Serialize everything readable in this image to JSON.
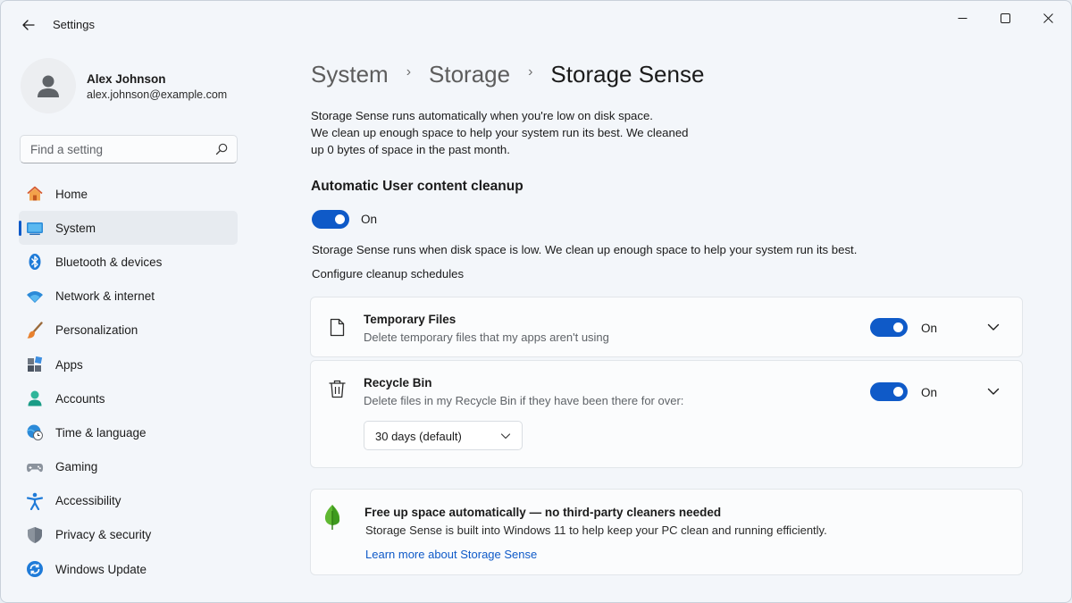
{
  "window": {
    "title": "Settings"
  },
  "user": {
    "name": "Alex Johnson",
    "email": "alex.johnson@example.com"
  },
  "search": {
    "placeholder": "Find a setting"
  },
  "sidebar": {
    "items": [
      {
        "label": "Home",
        "icon": "home-icon"
      },
      {
        "label": "System",
        "icon": "system-icon",
        "active": true
      },
      {
        "label": "Bluetooth & devices",
        "icon": "bluetooth-icon"
      },
      {
        "label": "Network & internet",
        "icon": "wifi-icon"
      },
      {
        "label": "Personalization",
        "icon": "brush-icon"
      },
      {
        "label": "Apps",
        "icon": "apps-icon"
      },
      {
        "label": "Accounts",
        "icon": "accounts-icon"
      },
      {
        "label": "Time & language",
        "icon": "clock-globe-icon"
      },
      {
        "label": "Gaming",
        "icon": "gamepad-icon"
      },
      {
        "label": "Accessibility",
        "icon": "accessibility-icon"
      },
      {
        "label": "Privacy & security",
        "icon": "shield-icon"
      },
      {
        "label": "Windows Update",
        "icon": "update-icon"
      }
    ]
  },
  "breadcrumb": {
    "items": [
      "System",
      "Storage",
      "Storage Sense"
    ],
    "separator": "›"
  },
  "description": [
    "Storage Sense runs automatically when you're low on disk space.",
    "We clean up enough space to help your system run its best. We cleaned",
    "up 0 bytes of space in the past month."
  ],
  "cleanup": {
    "title": "Automatic User content cleanup",
    "toggle_state": "On",
    "note": "Storage Sense runs when disk space is low. We clean up enough space to help your system run its best.",
    "config_label": "Configure cleanup schedules"
  },
  "cards": {
    "temp": {
      "title": "Temporary Files",
      "subtitle": "Delete temporary files that my apps aren't using",
      "toggle_state": "On"
    },
    "bin": {
      "title": "Recycle Bin",
      "subtitle": "Delete files in my Recycle Bin if they have been there for over:",
      "toggle_state": "On",
      "select_value": "30 days (default)"
    }
  },
  "info": {
    "title": "Free up space automatically — no third-party cleaners needed",
    "subtitle": "Storage Sense is built into Windows 11 to help keep your PC clean and running efficiently.",
    "link": "Learn more about Storage Sense"
  },
  "colors": {
    "accent": "#0f5ac8",
    "background": "#f3f6fa",
    "card": "#fbfcfd"
  }
}
